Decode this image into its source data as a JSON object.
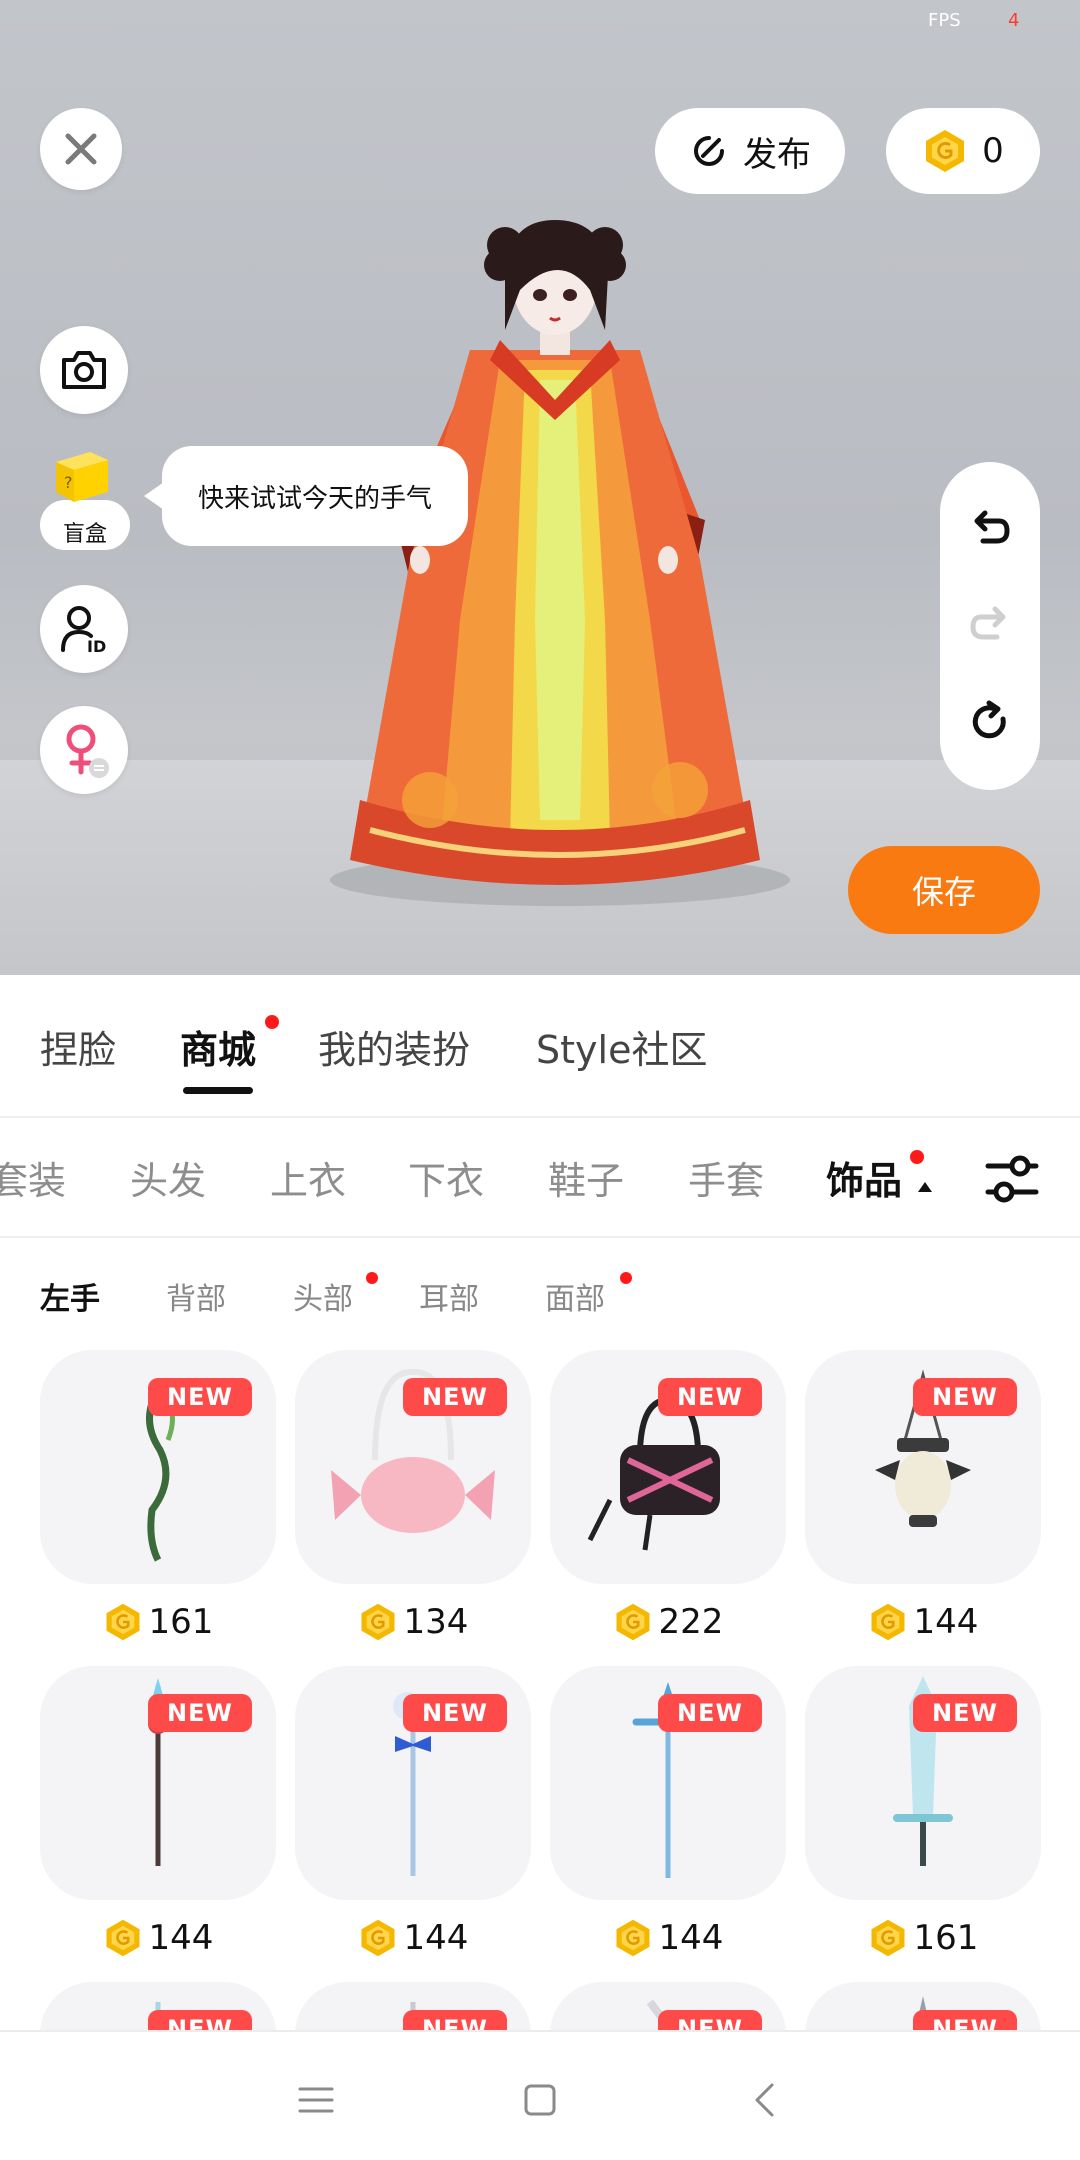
{
  "status": {
    "fps_label": "FPS",
    "fps_value": "4"
  },
  "top_bar": {
    "publish_label": "发布",
    "coins": "0"
  },
  "side_tools": {
    "blind_box_label": "盲盒",
    "tooltip": "快来试试今天的手气"
  },
  "save_label": "保存",
  "main_tabs": [
    {
      "label": "捏脸",
      "active": false,
      "dot": false
    },
    {
      "label": "商城",
      "active": true,
      "dot": true
    },
    {
      "label": "我的装扮",
      "active": false,
      "dot": false
    },
    {
      "label": "Style社区",
      "active": false,
      "dot": false
    }
  ],
  "categories": [
    {
      "label": "套装",
      "active": false
    },
    {
      "label": "头发",
      "active": false
    },
    {
      "label": "上衣",
      "active": false
    },
    {
      "label": "下衣",
      "active": false
    },
    {
      "label": "鞋子",
      "active": false
    },
    {
      "label": "手套",
      "active": false
    },
    {
      "label": "饰品",
      "active": true,
      "dot": true
    }
  ],
  "sub_categories": [
    {
      "label": "左手",
      "active": true,
      "dot": false
    },
    {
      "label": "背部",
      "active": false,
      "dot": false
    },
    {
      "label": "头部",
      "active": false,
      "dot": true
    },
    {
      "label": "耳部",
      "active": false,
      "dot": false
    },
    {
      "label": "面部",
      "active": false,
      "dot": true
    }
  ],
  "new_tag": "NEW",
  "items": [
    {
      "icon": "green-vine-staff",
      "price": "161",
      "is_new": true
    },
    {
      "icon": "pink-candy-bag",
      "price": "134",
      "is_new": true
    },
    {
      "icon": "black-pink-bag",
      "price": "222",
      "is_new": true
    },
    {
      "icon": "lantern",
      "price": "144",
      "is_new": true
    },
    {
      "icon": "red-gem-spear",
      "price": "144",
      "is_new": true
    },
    {
      "icon": "blue-bow-wand",
      "price": "144",
      "is_new": true
    },
    {
      "icon": "blue-cross-staff",
      "price": "144",
      "is_new": true
    },
    {
      "icon": "ice-sword",
      "price": "161",
      "is_new": true
    },
    {
      "icon": "partial-item",
      "price": "",
      "is_new": true
    },
    {
      "icon": "partial-item",
      "price": "",
      "is_new": true
    },
    {
      "icon": "partial-item",
      "price": "",
      "is_new": true
    },
    {
      "icon": "partial-item",
      "price": "",
      "is_new": true
    }
  ],
  "colors": {
    "accent": "#fa7a12",
    "new_tag": "#ff4a4a",
    "coin": "#f5b800",
    "dot": "#ff1a1a"
  }
}
